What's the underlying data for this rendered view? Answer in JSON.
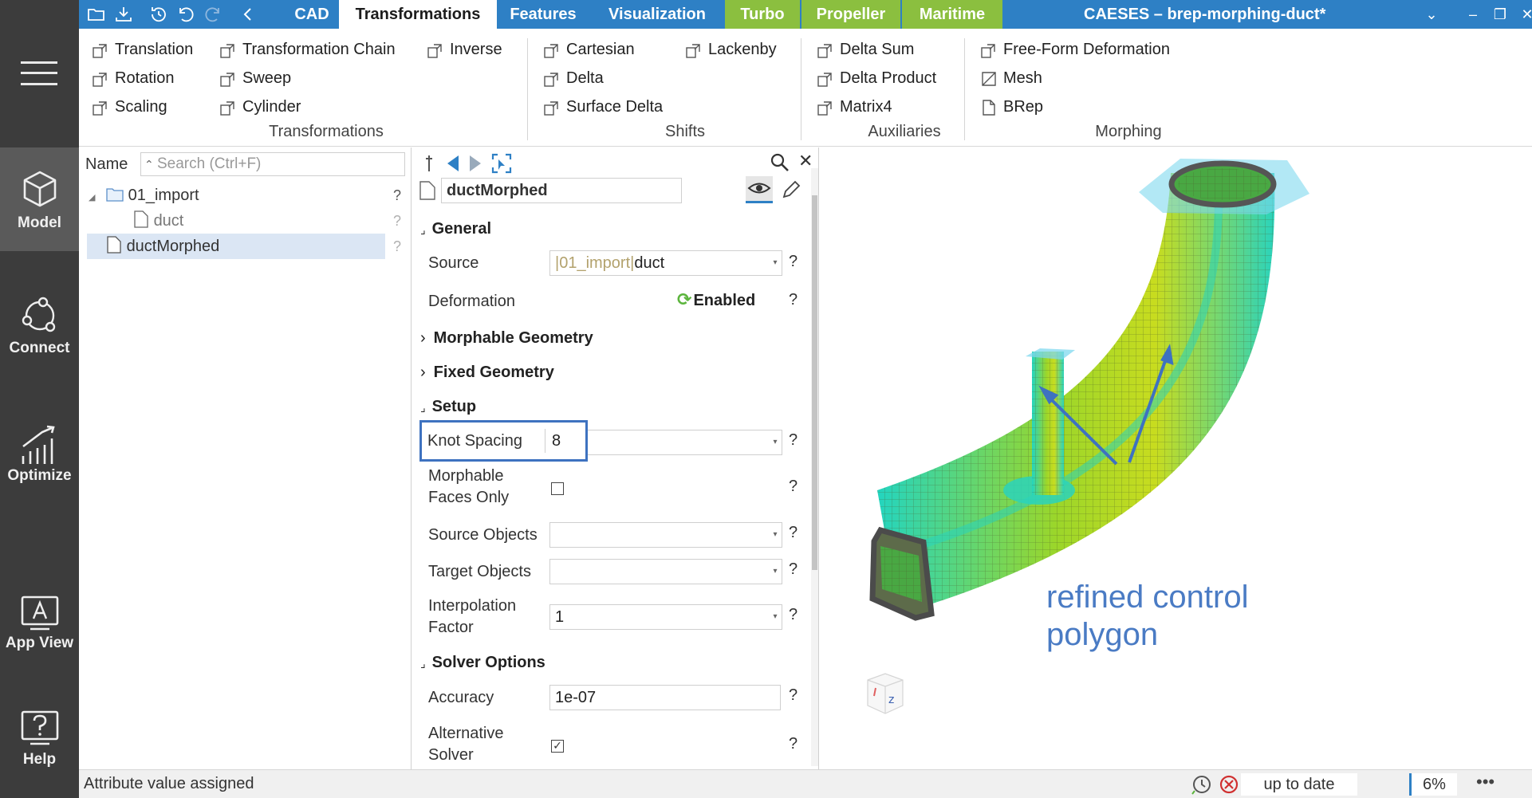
{
  "title_bar": {
    "tabs": [
      "CAD",
      "Transformations",
      "Features",
      "Visualization",
      "Turbo",
      "Propeller",
      "Maritime"
    ],
    "app_title": "CAESES – brep-morphing-duct*",
    "colors": {
      "bar": "#2e80c5",
      "green_tab": "#8bbf3f"
    }
  },
  "sidebar": {
    "items": [
      {
        "label": "Model",
        "icon": "cube-icon"
      },
      {
        "label": "Connect",
        "icon": "network-icon"
      },
      {
        "label": "Optimize",
        "icon": "chart-icon"
      },
      {
        "label": "App View",
        "icon": "app-view-icon"
      },
      {
        "label": "Help",
        "icon": "help-icon"
      }
    ]
  },
  "ribbon": {
    "transformations": [
      "Translation",
      "Rotation",
      "Scaling",
      "Transformation Chain",
      "Sweep",
      "Cylinder",
      "Inverse"
    ],
    "shifts": [
      "Cartesian",
      "Delta",
      "Surface Delta",
      "Lackenby"
    ],
    "auxiliaries": [
      "Delta Sum",
      "Delta Product",
      "Matrix4"
    ],
    "morphing": [
      "Free-Form Deformation",
      "Mesh",
      "BRep"
    ],
    "groups": [
      "Transformations",
      "Shifts",
      "Auxiliaries",
      "Morphing"
    ]
  },
  "tree": {
    "name_header": "Name",
    "search_placeholder": "Search (Ctrl+F)",
    "folder": "01_import",
    "child": "duct",
    "selected": "ductMorphed"
  },
  "properties": {
    "object_name": "ductMorphed",
    "sections": {
      "general": "General",
      "morphable": "Morphable Geometry",
      "fixed": "Fixed Geometry",
      "setup": "Setup",
      "solver": "Solver Options"
    },
    "source_label": "Source",
    "source_value_prefix": "|01_import|",
    "source_value": "duct",
    "deformation_label": "Deformation",
    "deformation_value": "Enabled",
    "knot_spacing_label": "Knot Spacing",
    "knot_spacing_value": "8",
    "morphable_faces_label_1": "Morphable",
    "morphable_faces_label_2": "Faces Only",
    "morphable_faces_checked": false,
    "source_objects_label": "Source Objects",
    "target_objects_label": "Target Objects",
    "interp_label_1": "Interpolation",
    "interp_label_2": "Factor",
    "interp_value": "1",
    "accuracy_label": "Accuracy",
    "accuracy_value": "1e-07",
    "alt_solver_label_1": "Alternative",
    "alt_solver_label_2": "Solver",
    "alt_solver_checked": true,
    "help_mark": "?"
  },
  "viewport": {
    "annotation_line1": "refined control",
    "annotation_line2": "polygon",
    "annotation_color": "#4a7bc4",
    "axis_label": "z"
  },
  "status": {
    "message": "Attribute value assigned",
    "state": "up to date",
    "zoom": "6%"
  }
}
